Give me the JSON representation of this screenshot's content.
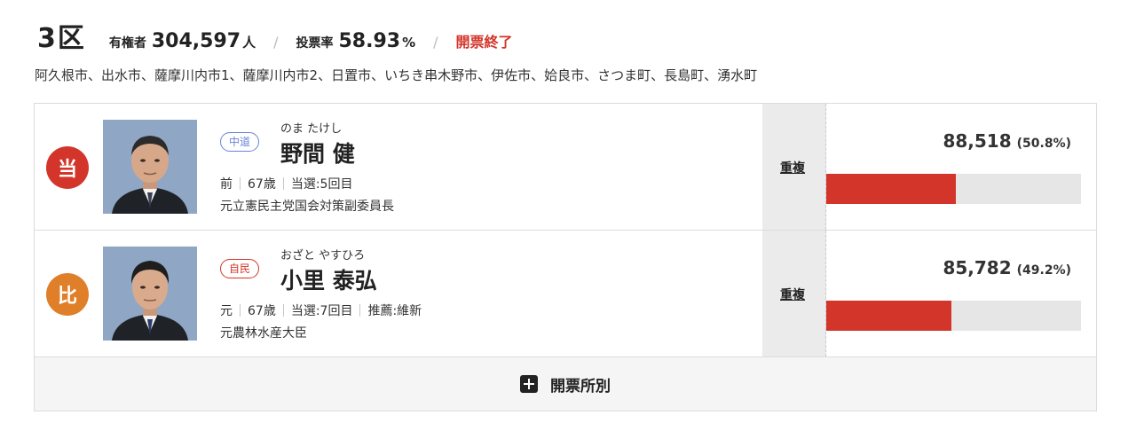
{
  "header": {
    "district": "3区",
    "voters_label": "有権者",
    "voters_value": "304,597",
    "voters_unit": "人",
    "turnout_label": "投票率",
    "turnout_value": "58.93",
    "turnout_unit": "%",
    "separator": "/",
    "status": "開票終了"
  },
  "areas": "阿久根市、出水市、薩摩川内市1、薩摩川内市2、日置市、いちき串木野市、伊佐市、姶良市、さつま町、長島町、湧水町",
  "colors": {
    "accent_red": "#d3352a",
    "elected_mark": "#d3352a",
    "pr_mark": "#e07f2a",
    "party_chudo": "#6b84d6",
    "party_jimin": "#d3352a"
  },
  "candidates": [
    {
      "mark": "当",
      "party": "中道",
      "kana": "のま たけし",
      "name": "野間 健",
      "status": "前",
      "age": "67歳",
      "wins": "当選:5回目",
      "endorsement": "",
      "career": "元立憲民主党国会対策副委員長",
      "duplicate": "重複",
      "votes": "88,518",
      "percent": "(50.8%)",
      "share": 0.508,
      "photo": "candidate-photo"
    },
    {
      "mark": "比",
      "party": "自民",
      "kana": "おざと やすひろ",
      "name": "小里 泰弘",
      "status": "元",
      "age": "67歳",
      "wins": "当選:7回目",
      "endorsement": "推薦:維新",
      "career": "元農林水産大臣",
      "duplicate": "重複",
      "votes": "85,782",
      "percent": "(49.2%)",
      "share": 0.492,
      "photo": "candidate-photo"
    }
  ],
  "breakdown": {
    "icon": "plus-square-icon",
    "label": "開票所別"
  }
}
